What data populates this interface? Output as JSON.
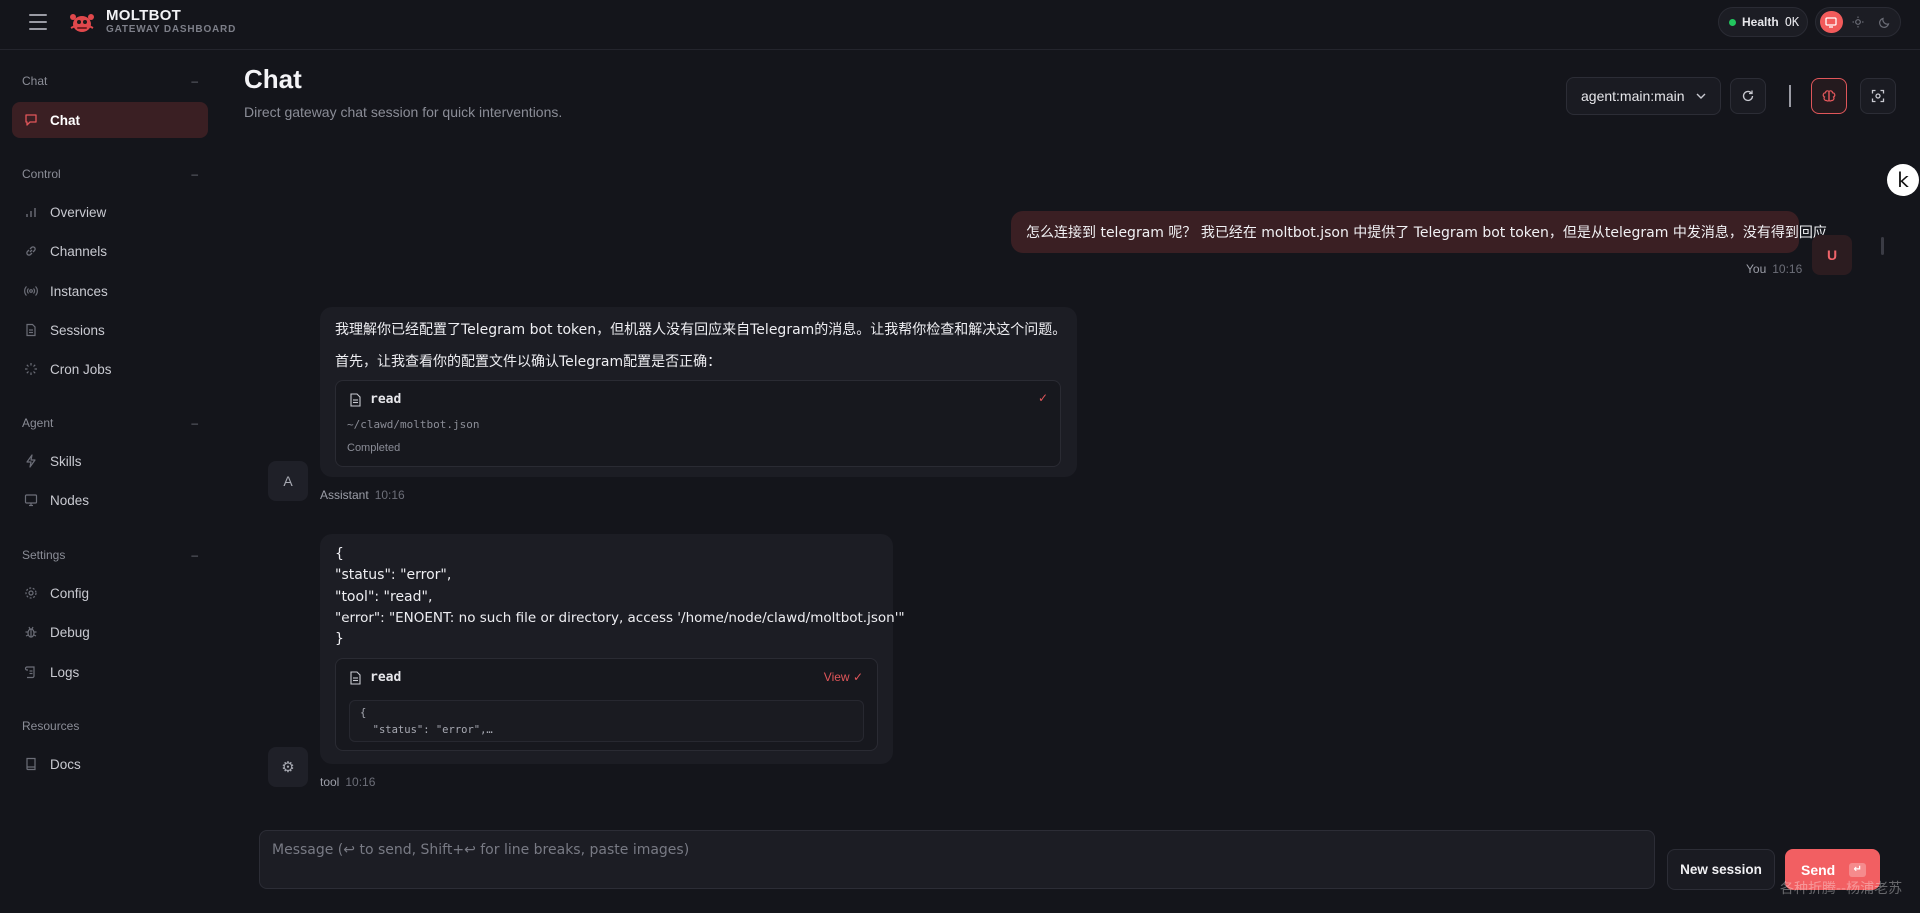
{
  "topbar": {
    "brand_title": "MOLTBOT",
    "brand_subtitle": "GATEWAY DASHBOARD",
    "health_label": "Health",
    "health_value": "OK"
  },
  "sidebar": {
    "groups": [
      {
        "title": "Chat",
        "items": [
          {
            "label": "Chat",
            "icon": "message-icon",
            "active": true
          }
        ]
      },
      {
        "title": "Control",
        "items": [
          {
            "label": "Overview",
            "icon": "bar-chart-icon"
          },
          {
            "label": "Channels",
            "icon": "link-icon"
          },
          {
            "label": "Instances",
            "icon": "radio-icon"
          },
          {
            "label": "Sessions",
            "icon": "file-icon"
          },
          {
            "label": "Cron Jobs",
            "icon": "loader-icon"
          }
        ]
      },
      {
        "title": "Agent",
        "items": [
          {
            "label": "Skills",
            "icon": "zap-icon"
          },
          {
            "label": "Nodes",
            "icon": "monitor-icon"
          }
        ]
      },
      {
        "title": "Settings",
        "items": [
          {
            "label": "Config",
            "icon": "gear-icon"
          },
          {
            "label": "Debug",
            "icon": "bug-icon"
          },
          {
            "label": "Logs",
            "icon": "scroll-icon"
          }
        ]
      },
      {
        "title": "Resources",
        "items": [
          {
            "label": "Docs",
            "icon": "book-icon"
          }
        ]
      }
    ]
  },
  "header": {
    "title": "Chat",
    "subtitle": "Direct gateway chat session for quick interventions.",
    "session_selected": "agent:main:main"
  },
  "messages": {
    "user": {
      "text": "怎么连接到 telegram 呢？ 我已经在 moltbot.json 中提供了 Telegram bot token，但是从telegram 中发消息，没有得到回应",
      "author": "You",
      "time": "10:16",
      "avatar": "U"
    },
    "assistant": {
      "line1": "我理解你已经配置了Telegram bot token，但机器人没有回应来自Telegram的消息。让我帮你检查和解决这个问题。",
      "line2": "首先，让我查看你的配置文件以确认Telegram配置是否正确：",
      "tool_name": "read",
      "tool_path": "~/clawd/moltbot.json",
      "tool_status": "Completed",
      "author": "Assistant",
      "time": "10:16",
      "avatar": "A"
    },
    "tool": {
      "lines": [
        "{",
        "\"status\": \"error\",",
        "\"tool\": \"read\",",
        "\"error\": \"ENOENT: no such file or directory, access '/home/node/clawd/moltbot.json'\"",
        "}"
      ],
      "tool_name": "read",
      "view_label": "View",
      "preview_line1": "{",
      "preview_line2": "  \"status\": \"error\",…",
      "author": "tool",
      "time": "10:16"
    }
  },
  "composer": {
    "placeholder": "Message (↩ to send, Shift+↩ for line breaks, paste images)",
    "value": "",
    "new_session_label": "New session",
    "send_label": "Send",
    "send_kbd": "↵"
  },
  "overlay": {
    "floating_letter": "k",
    "watermark": "各种折腾--杨浦老苏"
  },
  "colors": {
    "accent": "#f25f62",
    "background": "#14151b",
    "active_nav": "#3a1f23",
    "health_ok": "#22c55e"
  }
}
